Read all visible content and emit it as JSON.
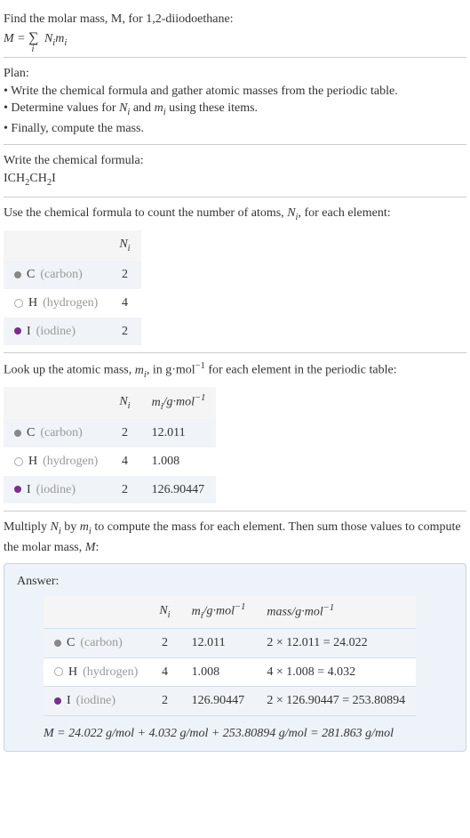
{
  "intro": {
    "line1": "Find the molar mass, M, for 1,2-diiodoethane:",
    "formula_lhs": "M = ",
    "formula_sum": "∑",
    "formula_sub": "i",
    "formula_rhs": " Nᵢmᵢ"
  },
  "plan": {
    "heading": "Plan:",
    "bullet1": "• Write the chemical formula and gather atomic masses from the periodic table.",
    "bullet2": "• Determine values for Nᵢ and mᵢ using these items.",
    "bullet3": "• Finally, compute the mass."
  },
  "chemFormula": {
    "heading": "Write the chemical formula:",
    "formula": "ICH₂CH₂I"
  },
  "countAtoms": {
    "heading": "Use the chemical formula to count the number of atoms, Nᵢ, for each element:",
    "header_ni": "Nᵢ",
    "rows": [
      {
        "sym": "C",
        "name": "(carbon)",
        "n": "2"
      },
      {
        "sym": "H",
        "name": "(hydrogen)",
        "n": "4"
      },
      {
        "sym": "I",
        "name": "(iodine)",
        "n": "2"
      }
    ]
  },
  "atomicMass": {
    "heading_a": "Look up the atomic mass, mᵢ, in g·mol",
    "heading_b": " for each element in the periodic table:",
    "header_ni": "Nᵢ",
    "header_mi": "mᵢ/g·mol⁻¹",
    "rows": [
      {
        "sym": "C",
        "name": "(carbon)",
        "n": "2",
        "m": "12.011"
      },
      {
        "sym": "H",
        "name": "(hydrogen)",
        "n": "4",
        "m": "1.008"
      },
      {
        "sym": "I",
        "name": "(iodine)",
        "n": "2",
        "m": "126.90447"
      }
    ]
  },
  "multiply": {
    "heading": "Multiply Nᵢ by mᵢ to compute the mass for each element. Then sum those values to compute the molar mass, M:"
  },
  "answer": {
    "label": "Answer:",
    "header_ni": "Nᵢ",
    "header_mi": "mᵢ/g·mol⁻¹",
    "header_mass": "mass/g·mol⁻¹",
    "rows": [
      {
        "sym": "C",
        "name": "(carbon)",
        "n": "2",
        "m": "12.011",
        "mass": "2 × 12.011 = 24.022"
      },
      {
        "sym": "H",
        "name": "(hydrogen)",
        "n": "4",
        "m": "1.008",
        "mass": "4 × 1.008 = 4.032"
      },
      {
        "sym": "I",
        "name": "(iodine)",
        "n": "2",
        "m": "126.90447",
        "mass": "2 × 126.90447 = 253.80894"
      }
    ],
    "final": "M = 24.022 g/mol + 4.032 g/mol + 253.80894 g/mol = 281.863 g/mol"
  }
}
